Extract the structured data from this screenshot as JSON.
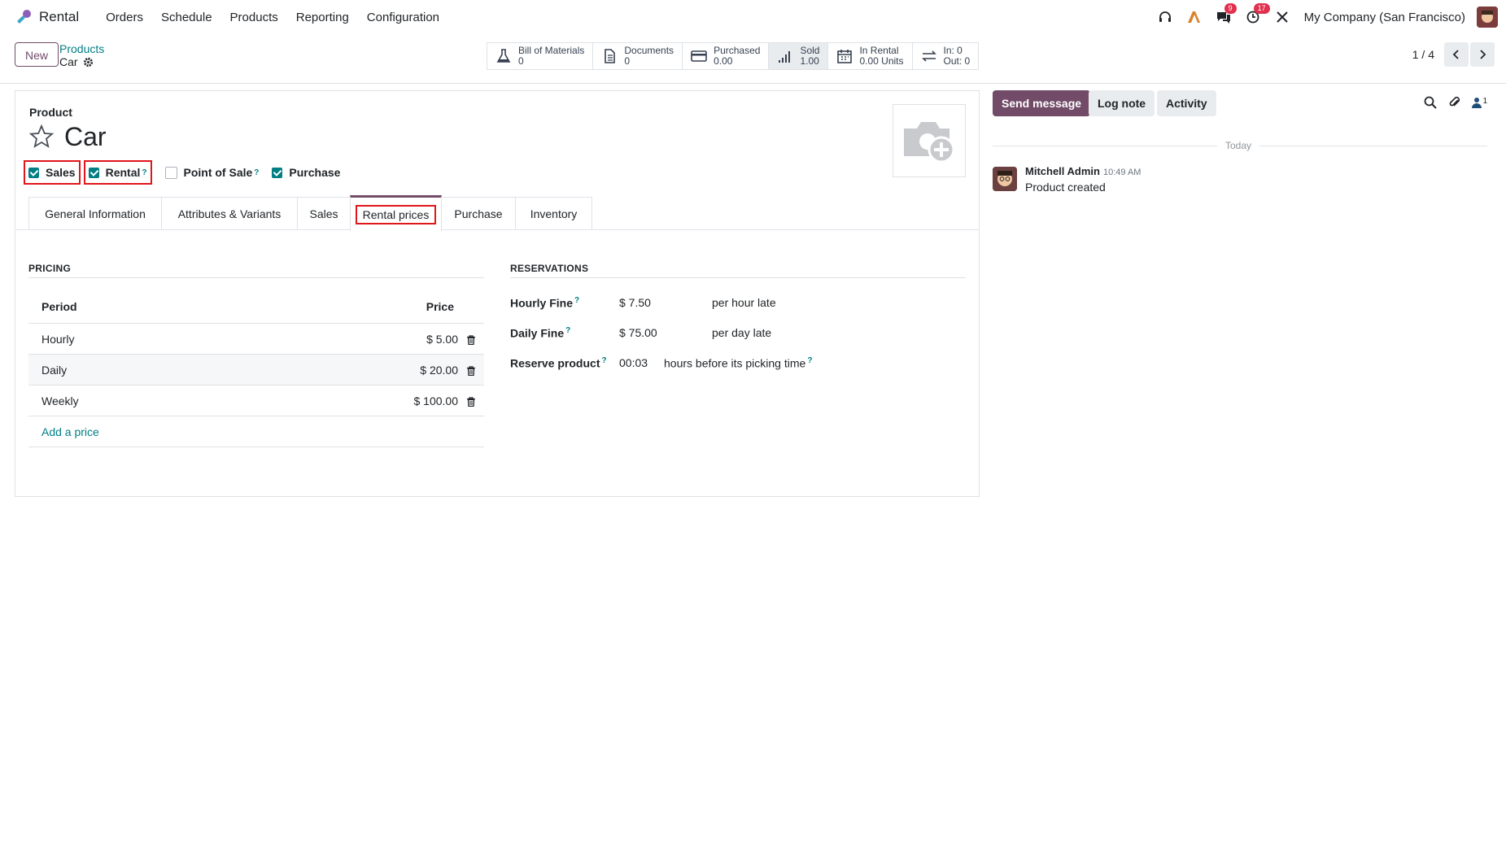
{
  "app": {
    "name": "Rental"
  },
  "menu": [
    "Orders",
    "Schedule",
    "Products",
    "Reporting",
    "Configuration"
  ],
  "systray": {
    "messages_badge": "9",
    "activities_badge": "17",
    "company": "My Company (San Francisco)"
  },
  "control": {
    "new_label": "New",
    "breadcrumb_parent": "Products",
    "breadcrumb_current": "Car",
    "pager": "1 / 4",
    "smart_buttons": [
      {
        "label": "Bill of Materials",
        "value": "0",
        "icon": "flask-icon"
      },
      {
        "label": "Documents",
        "value": "0",
        "icon": "document-icon"
      },
      {
        "label": "Purchased",
        "value": "0.00",
        "icon": "credit-card-icon"
      },
      {
        "label": "Sold",
        "value": "1.00",
        "icon": "signal-icon"
      },
      {
        "label": "In Rental",
        "value": "0.00 Units",
        "icon": "calendar-icon"
      },
      {
        "label": "In: 0",
        "value": "Out: 0",
        "icon": "exchange-icon"
      }
    ]
  },
  "form": {
    "label": "Product",
    "name": "Car",
    "options": [
      {
        "label": "Sales",
        "checked": true,
        "help": false
      },
      {
        "label": "Rental",
        "checked": true,
        "help": true
      },
      {
        "label": "Point of Sale",
        "checked": false,
        "help": true
      },
      {
        "label": "Purchase",
        "checked": true,
        "help": false
      }
    ],
    "tabs": [
      "General Information",
      "Attributes & Variants",
      "Sales",
      "Rental prices",
      "Purchase",
      "Inventory"
    ],
    "active_tab": "Rental prices",
    "pricing": {
      "title": "PRICING",
      "headers": {
        "period": "Period",
        "price": "Price"
      },
      "rows": [
        {
          "period": "Hourly",
          "price": "$ 5.00"
        },
        {
          "period": "Daily",
          "price": "$ 20.00"
        },
        {
          "period": "Weekly",
          "price": "$ 100.00"
        }
      ],
      "add_label": "Add a price"
    },
    "reservations": {
      "title": "RESERVATIONS",
      "hourly_fine": {
        "label": "Hourly Fine",
        "value": "$ 7.50",
        "suffix": "per hour late"
      },
      "daily_fine": {
        "label": "Daily Fine",
        "value": "$ 75.00",
        "suffix": "per day late"
      },
      "reserve": {
        "label": "Reserve product",
        "value": "00:03",
        "suffix": "hours before its picking time"
      }
    }
  },
  "chatter": {
    "send_message": "Send message",
    "log_note": "Log note",
    "activity": "Activity",
    "followers": "1",
    "today": "Today",
    "message": {
      "author": "Mitchell Admin",
      "time": "10:49 AM",
      "body": "Product created"
    }
  },
  "colors": {
    "brand": "#714b67",
    "accent": "#017e84",
    "highlight": "#e0161b"
  }
}
